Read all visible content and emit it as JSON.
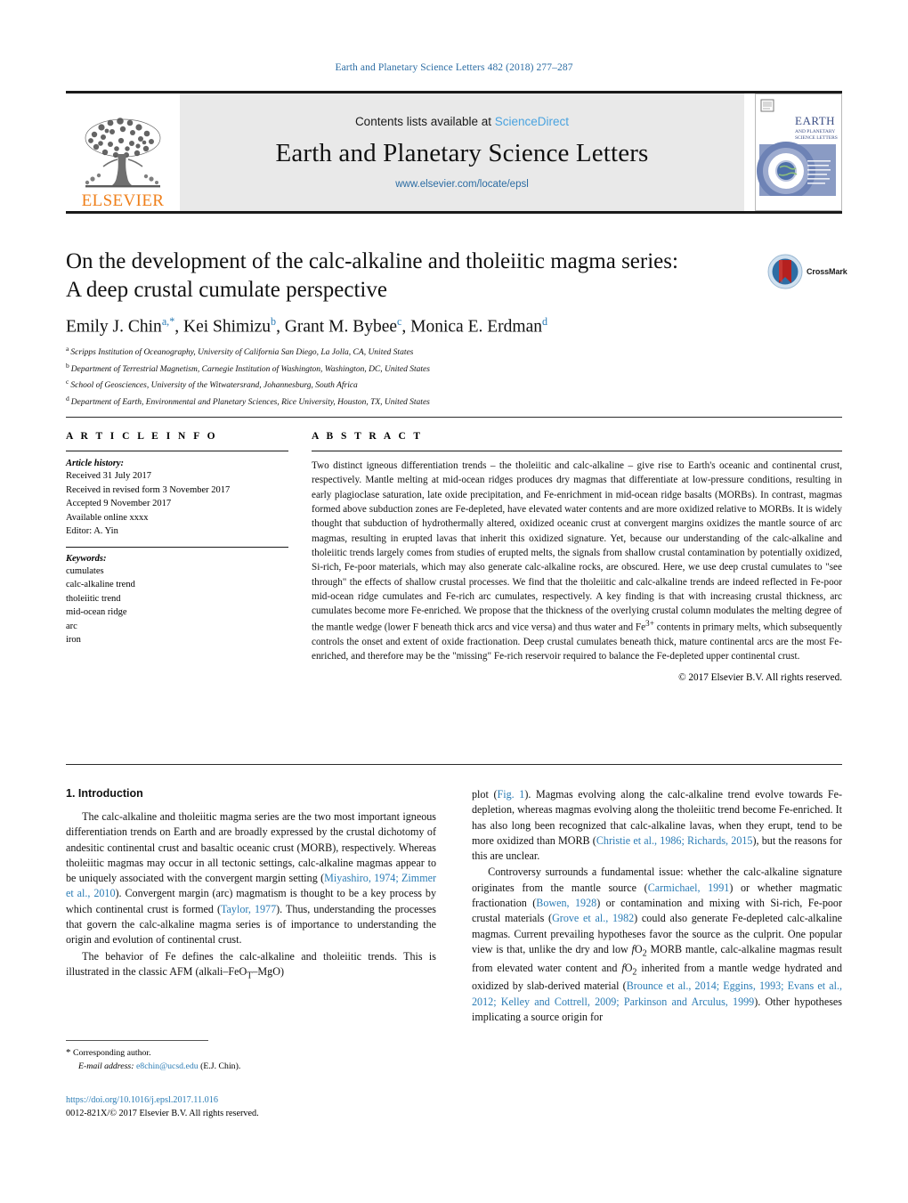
{
  "running_head": "Earth and Planetary Science Letters 482 (2018) 277–287",
  "masthead": {
    "publisher": "ELSEVIER",
    "contents_prefix": "Contents lists available at ",
    "sciencedirect": "ScienceDirect",
    "journal_title": "Earth and Planetary Science Letters",
    "journal_url": "www.elsevier.com/locate/epsl",
    "cover_title_line1": "EARTH",
    "cover_title_line2": "AND PLANETARY",
    "cover_title_line3": "SCIENCE LETTERS"
  },
  "article": {
    "title_line1": "On the development of the calc-alkaline and tholeiitic magma series:",
    "title_line2": "A deep crustal cumulate perspective",
    "crossmark_label": "CrossMark",
    "authors": [
      {
        "name": "Emily J. Chin",
        "sup": "a,*"
      },
      {
        "name": "Kei Shimizu",
        "sup": "b"
      },
      {
        "name": "Grant M. Bybee",
        "sup": "c"
      },
      {
        "name": "Monica E. Erdman",
        "sup": "d"
      }
    ],
    "affiliations": [
      {
        "mark": "a",
        "text": "Scripps Institution of Oceanography, University of California San Diego, La Jolla, CA, United States"
      },
      {
        "mark": "b",
        "text": "Department of Terrestrial Magnetism, Carnegie Institution of Washington, Washington, DC, United States"
      },
      {
        "mark": "c",
        "text": "School of Geosciences, University of the Witwatersrand, Johannesburg, South Africa"
      },
      {
        "mark": "d",
        "text": "Department of Earth, Environmental and Planetary Sciences, Rice University, Houston, TX, United States"
      }
    ]
  },
  "article_info": {
    "heading": "A R T I C L E    I N F O",
    "history_heading": "Article history:",
    "history": [
      "Received 31 July 2017",
      "Received in revised form 3 November 2017",
      "Accepted 9 November 2017",
      "Available online xxxx",
      "Editor: A. Yin"
    ],
    "keywords_heading": "Keywords:",
    "keywords": [
      "cumulates",
      "calc-alkaline trend",
      "tholeiitic trend",
      "mid-ocean ridge",
      "arc",
      "iron"
    ]
  },
  "abstract": {
    "heading": "A B S T R A C T",
    "text": "Two distinct igneous differentiation trends – the tholeiitic and calc-alkaline – give rise to Earth's oceanic and continental crust, respectively. Mantle melting at mid-ocean ridges produces dry magmas that differentiate at low-pressure conditions, resulting in early plagioclase saturation, late oxide precipitation, and Fe-enrichment in mid-ocean ridge basalts (MORBs). In contrast, magmas formed above subduction zones are Fe-depleted, have elevated water contents and are more oxidized relative to MORBs. It is widely thought that subduction of hydrothermally altered, oxidized oceanic crust at convergent margins oxidizes the mantle source of arc magmas, resulting in erupted lavas that inherit this oxidized signature. Yet, because our understanding of the calc-alkaline and tholeiitic trends largely comes from studies of erupted melts, the signals from shallow crustal contamination by potentially oxidized, Si-rich, Fe-poor materials, which may also generate calc-alkaline rocks, are obscured. Here, we use deep crustal cumulates to \"see through\" the effects of shallow crustal processes. We find that the tholeiitic and calc-alkaline trends are indeed reflected in Fe-poor mid-ocean ridge cumulates and Fe-rich arc cumulates, respectively. A key finding is that with increasing crustal thickness, arc cumulates become more Fe-enriched. We propose that the thickness of the overlying crustal column modulates the melting degree of the mantle wedge (lower F beneath thick arcs and vice versa) and thus water and Fe",
    "text_sup": "3+",
    "text_after_sup": " contents in primary melts, which subsequently controls the onset and extent of oxide fractionation. Deep crustal cumulates beneath thick, mature continental arcs are the most Fe-enriched, and therefore may be the \"missing\" Fe-rich reservoir required to balance the Fe-depleted upper continental crust.",
    "copyright": "© 2017 Elsevier B.V. All rights reserved."
  },
  "sections": {
    "intro_heading": "1. Introduction",
    "left_paragraphs": [
      {
        "parts": [
          {
            "t": "The calc-alkaline and tholeiitic magma series are the two most important igneous differentiation trends on Earth and are broadly expressed by the crustal dichotomy of andesitic continental crust and basaltic oceanic crust (MORB), respectively. Whereas tholeiitic magmas may occur in all tectonic settings, calc-alkaline magmas appear to be uniquely associated with the convergent margin setting ("
          },
          {
            "t": "Miyashiro, 1974; Zimmer et al., 2010",
            "ref": true
          },
          {
            "t": "). Convergent margin (arc) magmatism is thought to be a key process by which continental crust is formed ("
          },
          {
            "t": "Taylor, 1977",
            "ref": true
          },
          {
            "t": "). Thus, understanding the processes that govern the calc-alkaline magma series is of importance to understanding the origin and evolution of continental crust."
          }
        ]
      },
      {
        "parts": [
          {
            "t": "The behavior of Fe defines the calc-alkaline and tholeiitic trends. This is illustrated in the classic AFM (alkali–FeO"
          },
          {
            "t": "T",
            "sub": true
          },
          {
            "t": "–MgO)"
          }
        ]
      }
    ],
    "right_paragraphs": [
      {
        "continuation": true,
        "parts": [
          {
            "t": "plot ("
          },
          {
            "t": "Fig. 1",
            "ref": true
          },
          {
            "t": "). Magmas evolving along the calc-alkaline trend evolve towards Fe-depletion, whereas magmas evolving along the tholeiitic trend become Fe-enriched. It has also long been recognized that calc-alkaline lavas, when they erupt, tend to be more oxidized than MORB ("
          },
          {
            "t": "Christie et al., 1986; Richards, 2015",
            "ref": true
          },
          {
            "t": "), but the reasons for this are unclear."
          }
        ]
      },
      {
        "parts": [
          {
            "t": "Controversy surrounds a fundamental issue: whether the calc-alkaline signature originates from the mantle source ("
          },
          {
            "t": "Carmichael, 1991",
            "ref": true
          },
          {
            "t": ") or whether magmatic fractionation ("
          },
          {
            "t": "Bowen, 1928",
            "ref": true
          },
          {
            "t": ") or contamination and mixing with Si-rich, Fe-poor crustal materials ("
          },
          {
            "t": "Grove et al., 1982",
            "ref": true
          },
          {
            "t": ") could also generate Fe-depleted calc-alkaline magmas. Current prevailing hypotheses favor the source as the culprit. One popular view is that, unlike the dry and low "
          },
          {
            "t": "f",
            "ital": true
          },
          {
            "t": "O"
          },
          {
            "t": "2",
            "sub": true
          },
          {
            "t": " MORB mantle, calc-alkaline magmas result from elevated water content and "
          },
          {
            "t": "f",
            "ital": true
          },
          {
            "t": "O"
          },
          {
            "t": "2",
            "sub": true
          },
          {
            "t": " inherited from a mantle wedge hydrated and oxidized by slab-derived material ("
          },
          {
            "t": "Brounce et al., 2014; Eggins, 1993; Evans et al., 2012; Kelley and Cottrell, 2009; Parkinson and Arculus, 1999",
            "ref": true
          },
          {
            "t": "). Other hypotheses implicating a source origin for"
          }
        ]
      }
    ]
  },
  "footer": {
    "corresponding_marker": "*",
    "corresponding_text": "Corresponding author.",
    "email_label": "E-mail address:",
    "email": "e8chin@ucsd.edu",
    "email_suffix": "(E.J. Chin).",
    "doi": "https://doi.org/10.1016/j.epsl.2017.11.016",
    "issn_line": "0012-821X/© 2017 Elsevier B.V. All rights reserved."
  },
  "colors": {
    "link": "#2b7cb5",
    "sciencedirect": "#4aa3df",
    "elsevier_orange": "#ef7f1a",
    "band_gray": "#e9e9e9",
    "crossmark_blue": "#2e6da4",
    "crossmark_red": "#b5201f"
  }
}
